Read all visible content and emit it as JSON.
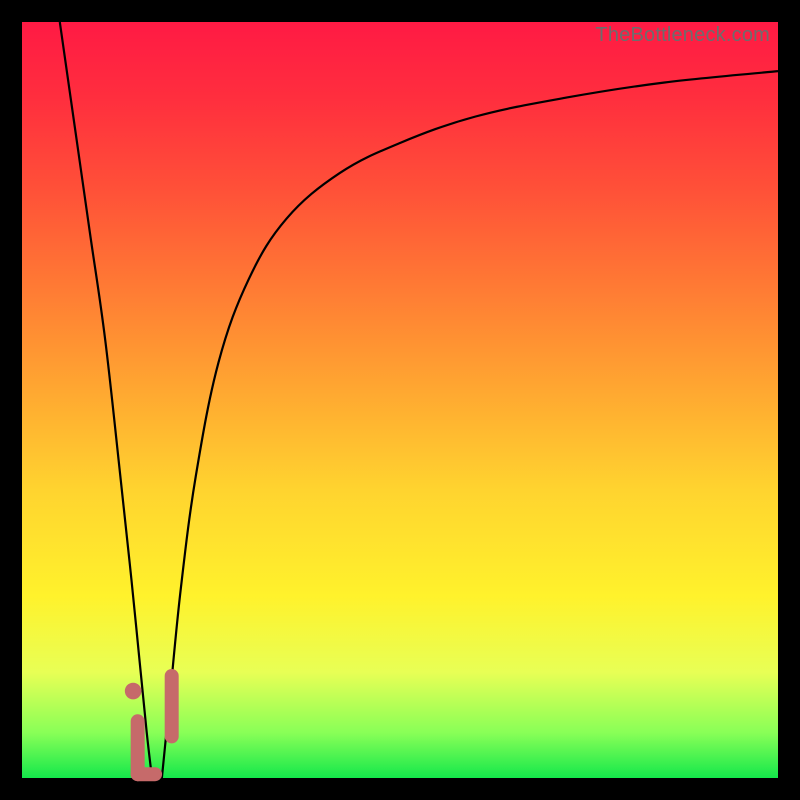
{
  "watermark": "TheBottleneck.com",
  "colors": {
    "frame": "#000000",
    "curve": "#000000",
    "marker": "#c66a6a",
    "gradient_stops": [
      "#ff1a44",
      "#ff2e3e",
      "#ff5038",
      "#ff7a34",
      "#ffa531",
      "#ffd42f",
      "#fff22c",
      "#e8ff55",
      "#89ff57",
      "#14e84b"
    ]
  },
  "chart_data": {
    "type": "line",
    "title": "",
    "xlabel": "",
    "ylabel": "",
    "xlim": [
      0,
      100
    ],
    "ylim": [
      0,
      100
    ],
    "series": [
      {
        "name": "left-branch",
        "x": [
          5,
          7,
          9,
          11,
          13,
          14.5,
          15.5,
          16.5,
          17.2
        ],
        "values": [
          100,
          86,
          72,
          58,
          40,
          26,
          16,
          6,
          0
        ]
      },
      {
        "name": "right-branch",
        "x": [
          18.5,
          19.5,
          21,
          23,
          26,
          30,
          35,
          42,
          50,
          60,
          72,
          85,
          100
        ],
        "values": [
          0,
          10,
          25,
          40,
          55,
          66,
          74,
          80,
          84,
          87.5,
          90,
          92,
          93.5
        ]
      }
    ],
    "markers": [
      {
        "shape": "dot",
        "x": 14.7,
        "y": 11.5,
        "r": 1.1
      },
      {
        "shape": "vcaps",
        "x": 15.3,
        "y_from": 7.5,
        "y_to": 0.5,
        "width": 1.9
      },
      {
        "shape": "hcaps",
        "x_from": 15.3,
        "x_to": 17.6,
        "y": 0.5,
        "width": 1.9
      },
      {
        "shape": "vcaps",
        "x": 19.8,
        "y_from": 13.5,
        "y_to": 5.5,
        "width": 1.9
      }
    ]
  }
}
